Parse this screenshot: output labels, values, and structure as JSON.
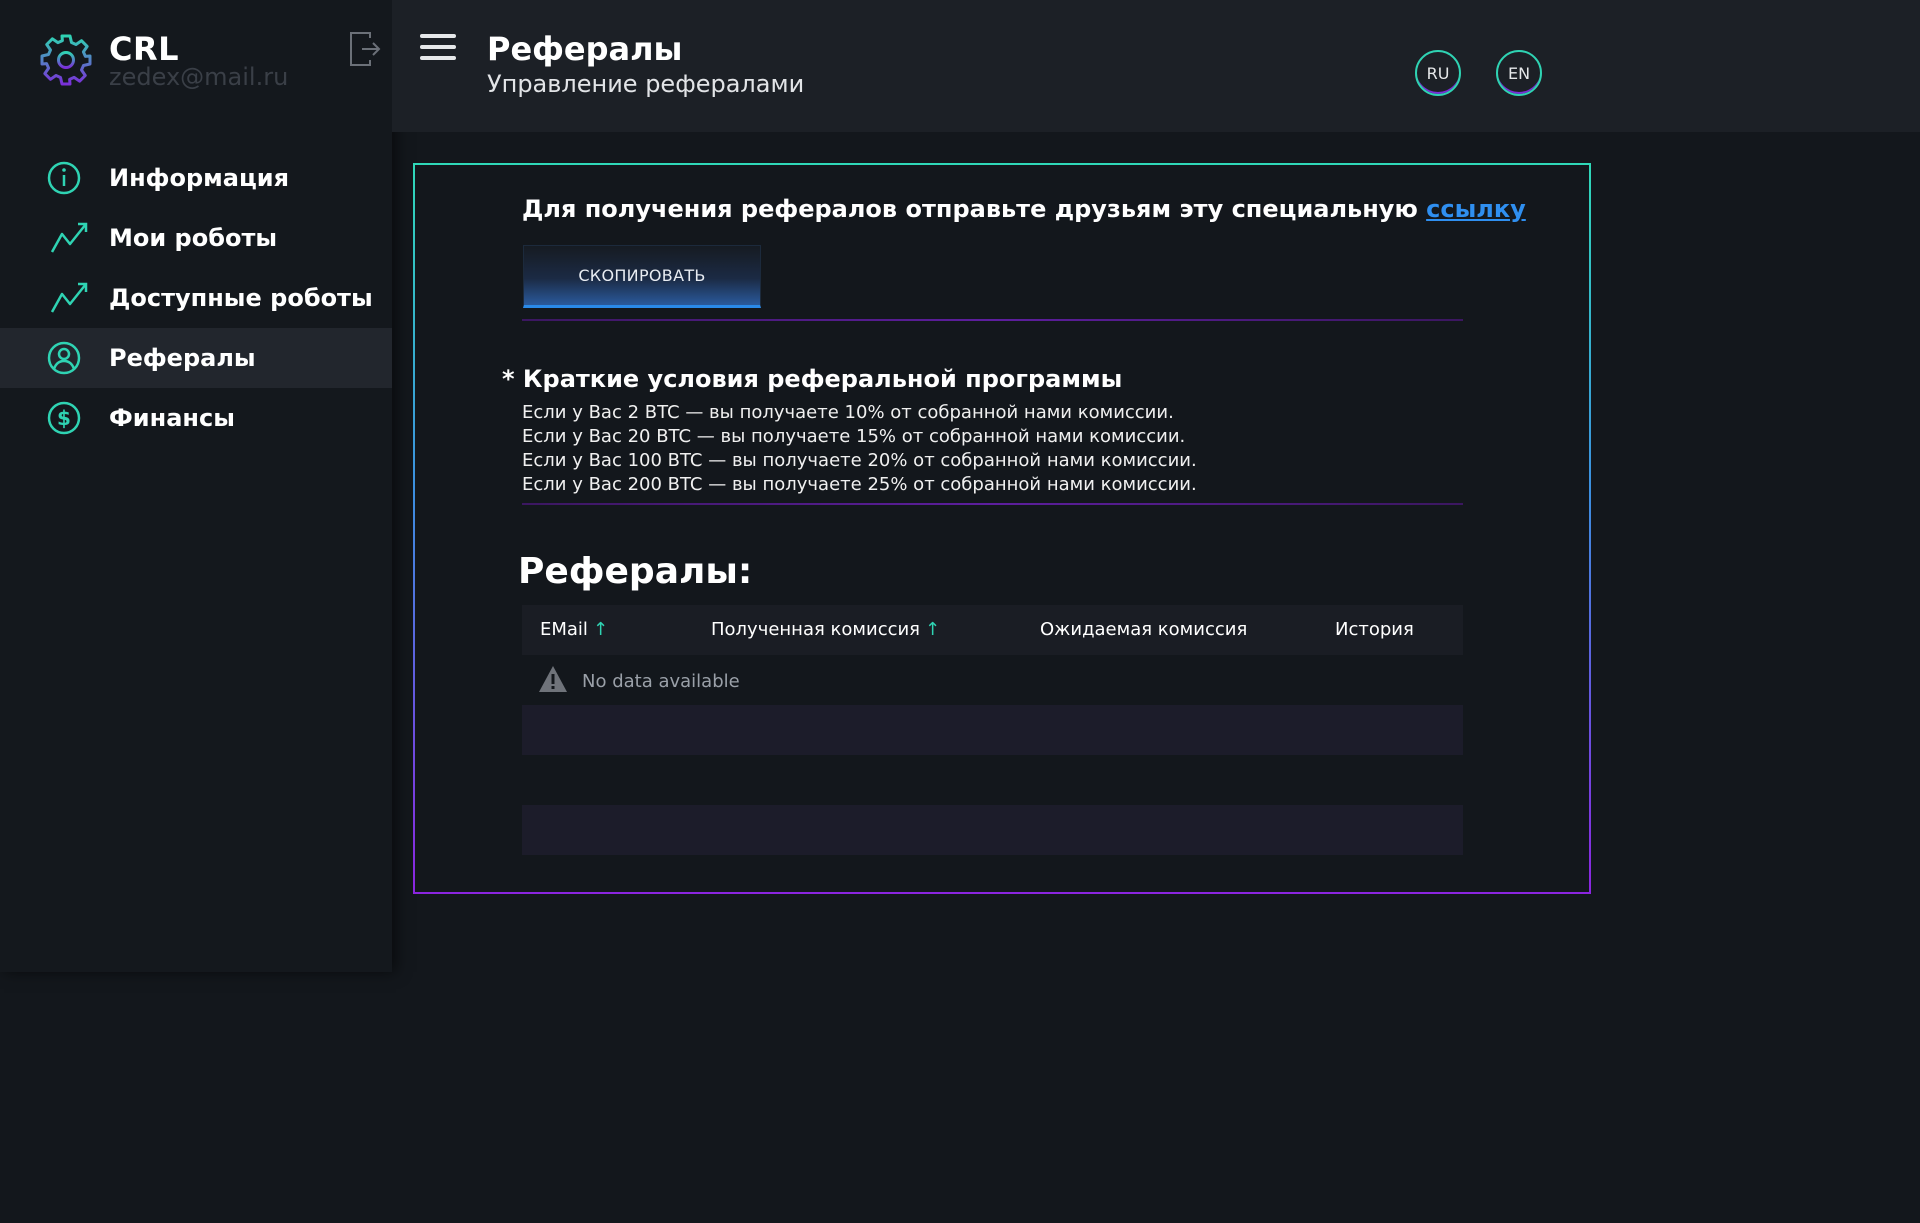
{
  "sidebar": {
    "brand_name": "CRL",
    "user_email": "zedex@mail.ru",
    "items": [
      {
        "label": "Информация",
        "icon": "info-icon"
      },
      {
        "label": "Мои роботы",
        "icon": "chart-line-icon"
      },
      {
        "label": "Доступные роботы",
        "icon": "chart-line-icon"
      },
      {
        "label": "Рефералы",
        "icon": "user-circle-icon",
        "active": true
      },
      {
        "label": "Финансы",
        "icon": "dollar-icon"
      }
    ]
  },
  "header": {
    "title": "Рефералы",
    "subtitle": "Управление рефералами",
    "languages": [
      "RU",
      "EN"
    ]
  },
  "referral": {
    "prompt": "Для получения рефералов отправьте друзьям эту специальную ",
    "link_label": "ссылку",
    "copy_button": "СКОПИРОВАТЬ"
  },
  "terms": {
    "title": "* Краткие условия реферальной программы",
    "lines": [
      "Если у Вас 2 BTC  — вы получаете 10% от собранной нами комиссии.",
      "Если у Вас 20 BTC  — вы получаете 15% от собранной нами комиссии.",
      "Если у Вас 100 BTC  — вы получаете 20% от собранной нами комиссии.",
      "Если у Вас 200 BTC  — вы получаете 25% от собранной нами комиссии."
    ]
  },
  "referrals_table": {
    "heading": "Рефералы:",
    "columns": [
      "EMail",
      "Полученная комиссия",
      "Ожидаемая комиссия",
      "История"
    ],
    "sort_arrow": "↑",
    "empty_text": "No data available"
  },
  "colors": {
    "accent_teal": "#2fd3b3",
    "accent_purple": "#8b25e0",
    "link_blue": "#2f8ff0",
    "background": "#13171c"
  }
}
